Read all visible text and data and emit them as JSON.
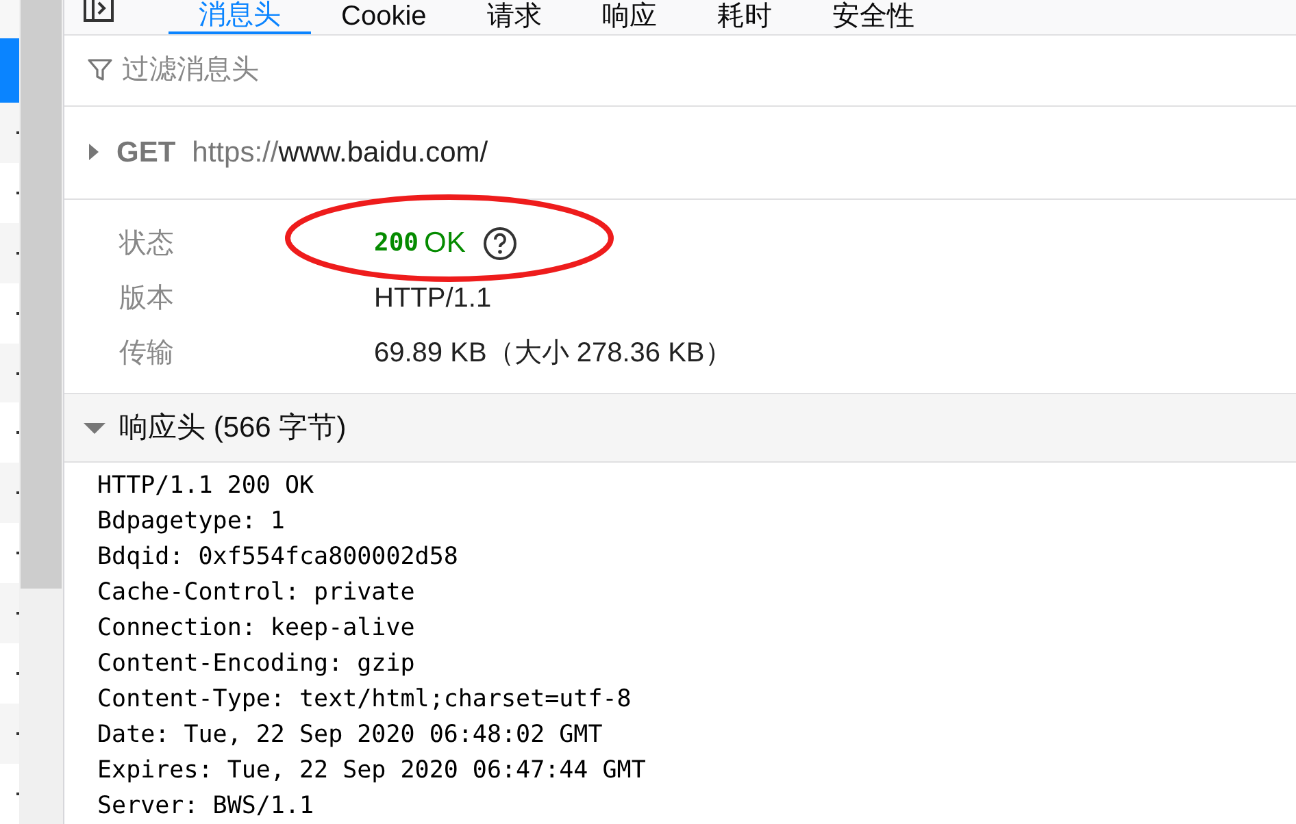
{
  "tabs": [
    {
      "label": "消息头",
      "selected": true
    },
    {
      "label": "Cookie",
      "selected": false
    },
    {
      "label": "请求",
      "selected": false
    },
    {
      "label": "响应",
      "selected": false
    },
    {
      "label": "耗时",
      "selected": false
    },
    {
      "label": "安全性",
      "selected": false
    }
  ],
  "filter": {
    "placeholder": "过滤消息头"
  },
  "request": {
    "expanded": false,
    "method": "GET",
    "scheme": "https://",
    "host_path": "www.baidu.com/"
  },
  "summary": [
    {
      "label": "状态",
      "kind": "status",
      "code": "200",
      "text": "OK"
    },
    {
      "label": "版本",
      "kind": "plain",
      "value": "HTTP/1.1"
    },
    {
      "label": "传输",
      "kind": "plain",
      "value": "69.89 KB（大小 278.36 KB）"
    }
  ],
  "response_headers": {
    "title": "响应头 (566 字节)",
    "expanded": true,
    "lines": [
      "HTTP/1.1 200 OK",
      "Bdpagetype: 1",
      "Bdqid: 0xf554fca800002d58",
      "Cache-Control: private",
      "Connection: keep-alive",
      "Content-Encoding: gzip",
      "Content-Type: text/html;charset=utf-8",
      "Date: Tue, 22 Sep 2020 06:48:02 GMT",
      "Expires: Tue, 22 Sep 2020 06:47:44 GMT",
      "Server: BWS/1.1"
    ]
  }
}
